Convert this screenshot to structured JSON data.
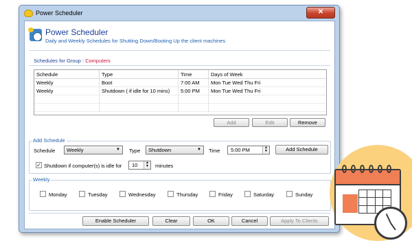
{
  "window": {
    "title": "Power Scheduler",
    "close_label": "✕"
  },
  "header": {
    "title": "Power Scheduler",
    "subtitle": "Daily and Weekly Schedules for Shutting Down/Booting Up the client machines"
  },
  "group": {
    "label": "Schedules for Group :",
    "value": "Computers"
  },
  "table": {
    "columns": [
      "Schedule",
      "Type",
      "Time",
      "Days of Week"
    ],
    "rows": [
      [
        "Weekly",
        "Boot",
        "7:00 AM",
        "Mon Tue Wed Thu Fri"
      ],
      [
        "Weekly",
        "Shutdown ( if idle for 10 mins)",
        "5:00 PM",
        "Mon Tue Wed Thu Fri"
      ]
    ]
  },
  "table_buttons": {
    "add": "Add",
    "edit": "Edit",
    "remove": "Remove"
  },
  "add_schedule": {
    "legend": "Add Schedule",
    "schedule_label": "Schedule",
    "schedule_value": "Weekly",
    "type_label": "Type",
    "type_value": "Shutdown",
    "time_label": "Time",
    "time_value": "5:00 PM",
    "add_button": "Add Schedule",
    "idle_checkbox_label": "Shutdown if computer(s) is idle for",
    "idle_checked": true,
    "idle_value": "10",
    "idle_unit": "minutes"
  },
  "weekly": {
    "legend": "Weekly",
    "days": [
      "Monday",
      "Tuesday",
      "Wednesday",
      "Thursday",
      "Friday",
      "Saturday",
      "Sunday"
    ]
  },
  "footer": {
    "enable": "Enable Scheduler",
    "clear": "Clear",
    "ok": "OK",
    "cancel": "Cancel",
    "apply": "Apply To Clients"
  },
  "colors": {
    "accent_blue": "#1f5fb0",
    "group_red": "#c8143c",
    "calendar_orange": "#f07f56",
    "decor_yellow": "#fcd17e"
  },
  "icons": [
    "app-icon",
    "close-icon",
    "checkbox-icon",
    "chevron-down-icon",
    "spin-arrows-icon",
    "calendar-icon",
    "clock-icon"
  ]
}
